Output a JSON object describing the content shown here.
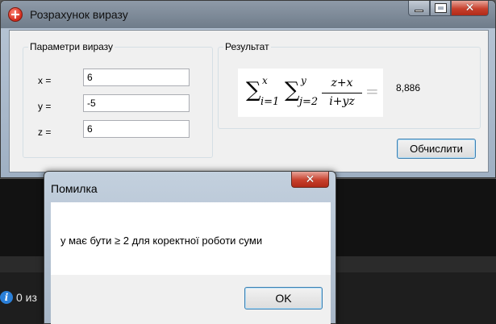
{
  "main_window": {
    "title": "Розрахунок виразу",
    "controls": {
      "minimize": "minimize",
      "maximize": "maximize",
      "close": "✕"
    }
  },
  "params_group": {
    "legend": "Параметри виразу",
    "rows": [
      {
        "label": "x =",
        "value": "6"
      },
      {
        "label": "y =",
        "value": "-5"
      },
      {
        "label": "z =",
        "value": "6"
      }
    ]
  },
  "result_group": {
    "legend": "Результат",
    "formula": {
      "sum": "∑",
      "outer_sub": "i=1",
      "outer_sup": "x",
      "inner_sub": "j=2",
      "inner_sup": "y",
      "numerator": "z+x",
      "denominator": "i+yz",
      "equals": "="
    },
    "value": "8,886"
  },
  "calculate_button": "Обчислити",
  "error_dialog": {
    "title": "Помилка",
    "close": "✕",
    "message": "y має бути ≥ 2 для коректної роботи суми",
    "ok_button": "OK"
  },
  "background_status": {
    "icon": "info-icon",
    "text": "0 из"
  },
  "colors": {
    "close_button": "#c7402c",
    "button_focus_border": "#3c7fb1",
    "info_icon": "#2a7fd8"
  }
}
